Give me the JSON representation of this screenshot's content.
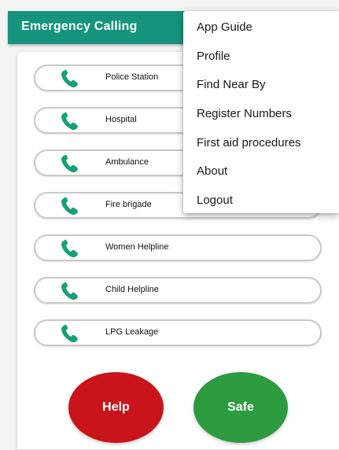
{
  "app": {
    "title": "Emergency Calling"
  },
  "contacts": [
    {
      "label": "Police Station",
      "icon": "phone-icon"
    },
    {
      "label": "Hospital",
      "icon": "phone-icon"
    },
    {
      "label": "Ambulance",
      "icon": "phone-icon"
    },
    {
      "label": "Fire brigade",
      "icon": "phone-icon"
    },
    {
      "label": "Women Helpline",
      "icon": "phone-icon"
    },
    {
      "label": "Child Helpline",
      "icon": "phone-icon"
    },
    {
      "label": "LPG Leakage",
      "icon": "phone-icon"
    }
  ],
  "actions": {
    "help_label": "Help",
    "safe_label": "Safe"
  },
  "menu": {
    "items": [
      "App Guide",
      "Profile",
      "Find Near By",
      "Register Numbers",
      "First aid procedures",
      "About",
      "Logout"
    ]
  },
  "colors": {
    "appbar": "#15937d",
    "phone_icon": "#17a077",
    "help": "#c8141a",
    "safe": "#2d9b3f"
  }
}
